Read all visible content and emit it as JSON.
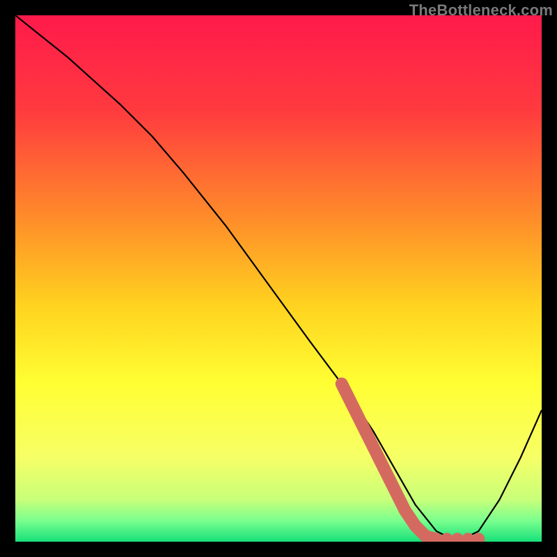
{
  "watermark": "TheBottleneck.com",
  "chart_data": {
    "type": "line",
    "title": "",
    "xlabel": "",
    "ylabel": "",
    "xlim": [
      0,
      100
    ],
    "ylim": [
      0,
      100
    ],
    "grid": false,
    "legend": false,
    "gradient_stops": [
      {
        "offset": 0,
        "color": "#ff1a4b"
      },
      {
        "offset": 18,
        "color": "#ff3a3f"
      },
      {
        "offset": 38,
        "color": "#ff8a2a"
      },
      {
        "offset": 55,
        "color": "#ffd21f"
      },
      {
        "offset": 70,
        "color": "#ffff33"
      },
      {
        "offset": 84,
        "color": "#f6ff66"
      },
      {
        "offset": 92,
        "color": "#c8ff7a"
      },
      {
        "offset": 96,
        "color": "#7aff8e"
      },
      {
        "offset": 100,
        "color": "#17e07a"
      }
    ],
    "series": [
      {
        "name": "bottleneck-curve",
        "color": "#000000",
        "x": [
          0,
          10,
          20,
          26,
          32,
          40,
          48,
          56,
          62,
          68,
          72,
          76,
          80,
          84,
          88,
          92,
          96,
          100
        ],
        "y": [
          100,
          92,
          83,
          77,
          70,
          60,
          49,
          38,
          30,
          21,
          14,
          7,
          2,
          0,
          2,
          8,
          16,
          25
        ]
      }
    ],
    "highlight": {
      "name": "operating-range",
      "color": "#d46a5f",
      "points_xy": [
        [
          62,
          30
        ],
        [
          64,
          26
        ],
        [
          66,
          22
        ],
        [
          68,
          18
        ],
        [
          70,
          14
        ],
        [
          72,
          10
        ],
        [
          74,
          6
        ],
        [
          76,
          3
        ],
        [
          78,
          1
        ],
        [
          80,
          0.5
        ],
        [
          82,
          0.5
        ],
        [
          84,
          0.5
        ],
        [
          86,
          0.5
        ],
        [
          88,
          0.5
        ]
      ],
      "dot_radius": 9
    }
  }
}
